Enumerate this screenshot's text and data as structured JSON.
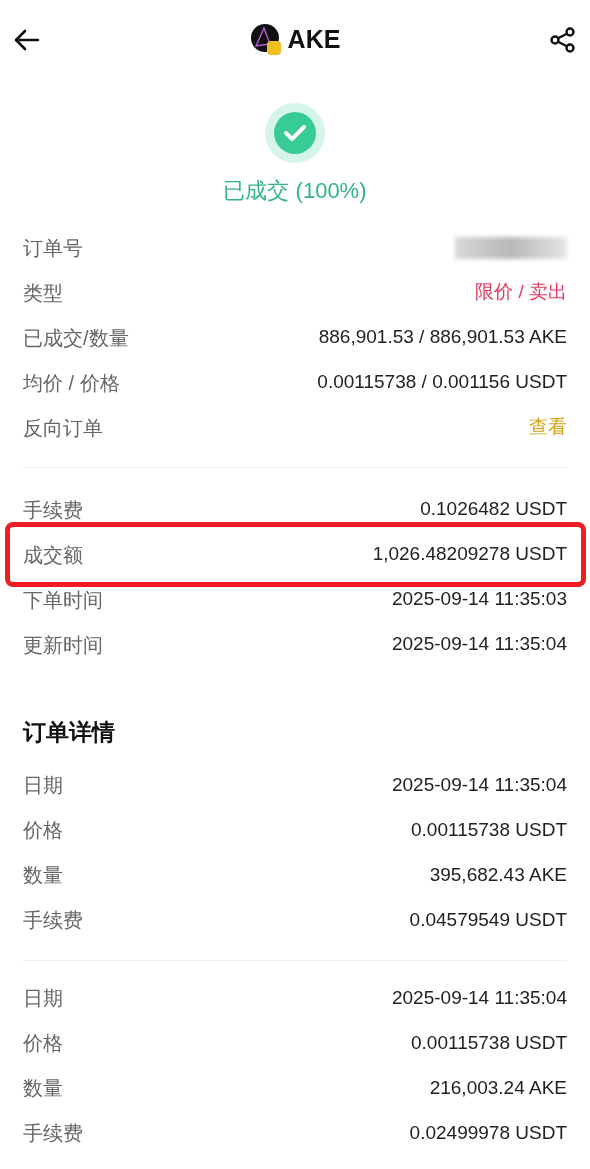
{
  "header": {
    "title": "AKE"
  },
  "status": {
    "text": "已成交 (100%)",
    "done": true
  },
  "summary": [
    [
      {
        "label": "订单号",
        "kind": "redacted",
        "highlighted": false
      },
      {
        "label": "类型",
        "value": "限价 / 卖出",
        "kind": "sell",
        "highlighted": false
      },
      {
        "label": "已成交/数量",
        "value": "886,901.53 / 886,901.53 AKE",
        "kind": "plain",
        "highlighted": false
      },
      {
        "label": "均价 / 价格",
        "value": "0.00115738 / 0.001156 USDT",
        "kind": "plain",
        "highlighted": false
      },
      {
        "label": "反向订单",
        "value": "查看",
        "kind": "link",
        "highlighted": false
      }
    ],
    [
      {
        "label": "手续费",
        "value": "0.1026482 USDT",
        "kind": "plain",
        "highlighted": false
      },
      {
        "label": "成交额",
        "value": "1,026.48209278 USDT",
        "kind": "plain",
        "highlighted": true
      },
      {
        "label": "下单时间",
        "value": "2025-09-14 11:35:03",
        "kind": "plain",
        "highlighted": false
      },
      {
        "label": "更新时间",
        "value": "2025-09-14 11:35:04",
        "kind": "plain",
        "highlighted": false
      }
    ]
  ],
  "details": {
    "title": "订单详情",
    "fills": [
      [
        {
          "label": "日期",
          "value": "2025-09-14 11:35:04"
        },
        {
          "label": "价格",
          "value": "0.00115738 USDT"
        },
        {
          "label": "数量",
          "value": "395,682.43 AKE"
        },
        {
          "label": "手续费",
          "value": "0.04579549 USDT"
        }
      ],
      [
        {
          "label": "日期",
          "value": "2025-09-14 11:35:04"
        },
        {
          "label": "价格",
          "value": "0.00115738 USDT"
        },
        {
          "label": "数量",
          "value": "216,003.24 AKE"
        },
        {
          "label": "手续费",
          "value": "0.02499978 USDT"
        }
      ]
    ]
  }
}
